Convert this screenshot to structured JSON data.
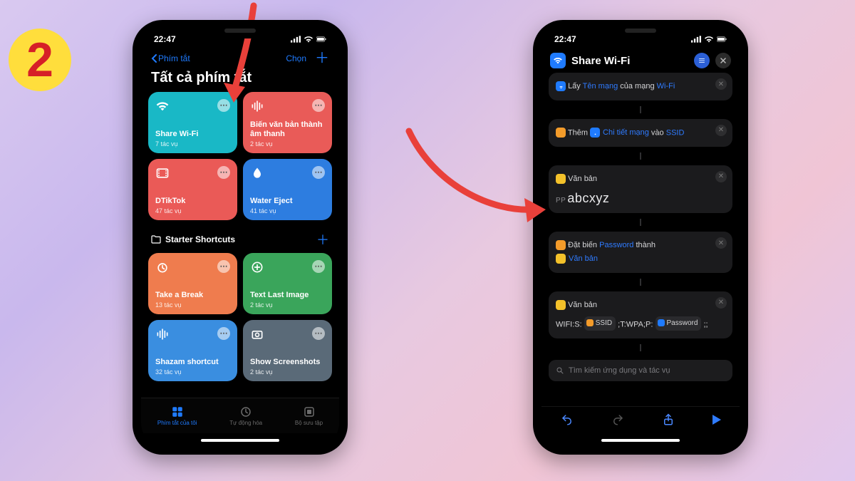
{
  "step_number": "2",
  "status_time": "22:47",
  "left": {
    "back_label": "Phím tắt",
    "select_label": "Chọn",
    "title": "Tất cả phím tắt",
    "tiles": [
      {
        "name": "Share Wi-Fi",
        "sub": "7 tác vụ"
      },
      {
        "name": "Biến văn bản thành âm thanh",
        "sub": "2 tác vụ"
      },
      {
        "name": "DTikTok",
        "sub": "47 tác vụ"
      },
      {
        "name": "Water Eject",
        "sub": "41 tác vụ"
      }
    ],
    "folder_label": "Starter Shortcuts",
    "starter": [
      {
        "name": "Take a Break",
        "sub": "13 tác vụ"
      },
      {
        "name": "Text Last Image",
        "sub": "2 tác vụ"
      },
      {
        "name": "Shazam shortcut",
        "sub": "32 tác vụ"
      },
      {
        "name": "Show Screenshots",
        "sub": "2 tác vụ"
      }
    ],
    "tabs": {
      "mine": "Phím tắt của tôi",
      "automation": "Tự động hóa",
      "gallery": "Bộ sưu tập"
    }
  },
  "right": {
    "title": "Share Wi-Fi",
    "a1": {
      "lead": "Lấy",
      "tok": "Tên mạng",
      "mid": "của mạng",
      "tail": "Wi-Fi"
    },
    "a2": {
      "lead": "Thêm",
      "chip": "Chi tiết mạng",
      "mid": "vào",
      "tok": "SSID"
    },
    "a3": {
      "label": "Văn bản",
      "prefix": "PP",
      "value": "abcxyz"
    },
    "a4": {
      "lead": "Đặt biến",
      "tok1": "Password",
      "mid": "thành",
      "chip": "Văn bản"
    },
    "a5": {
      "label": "Văn bản",
      "p1": "WIFI:S:",
      "pill1": "SSID",
      "p2": ";T:WPA;P:",
      "pill2": "Password",
      "p3": ";;"
    },
    "search_placeholder": "Tìm kiếm ứng dụng và tác vụ"
  }
}
